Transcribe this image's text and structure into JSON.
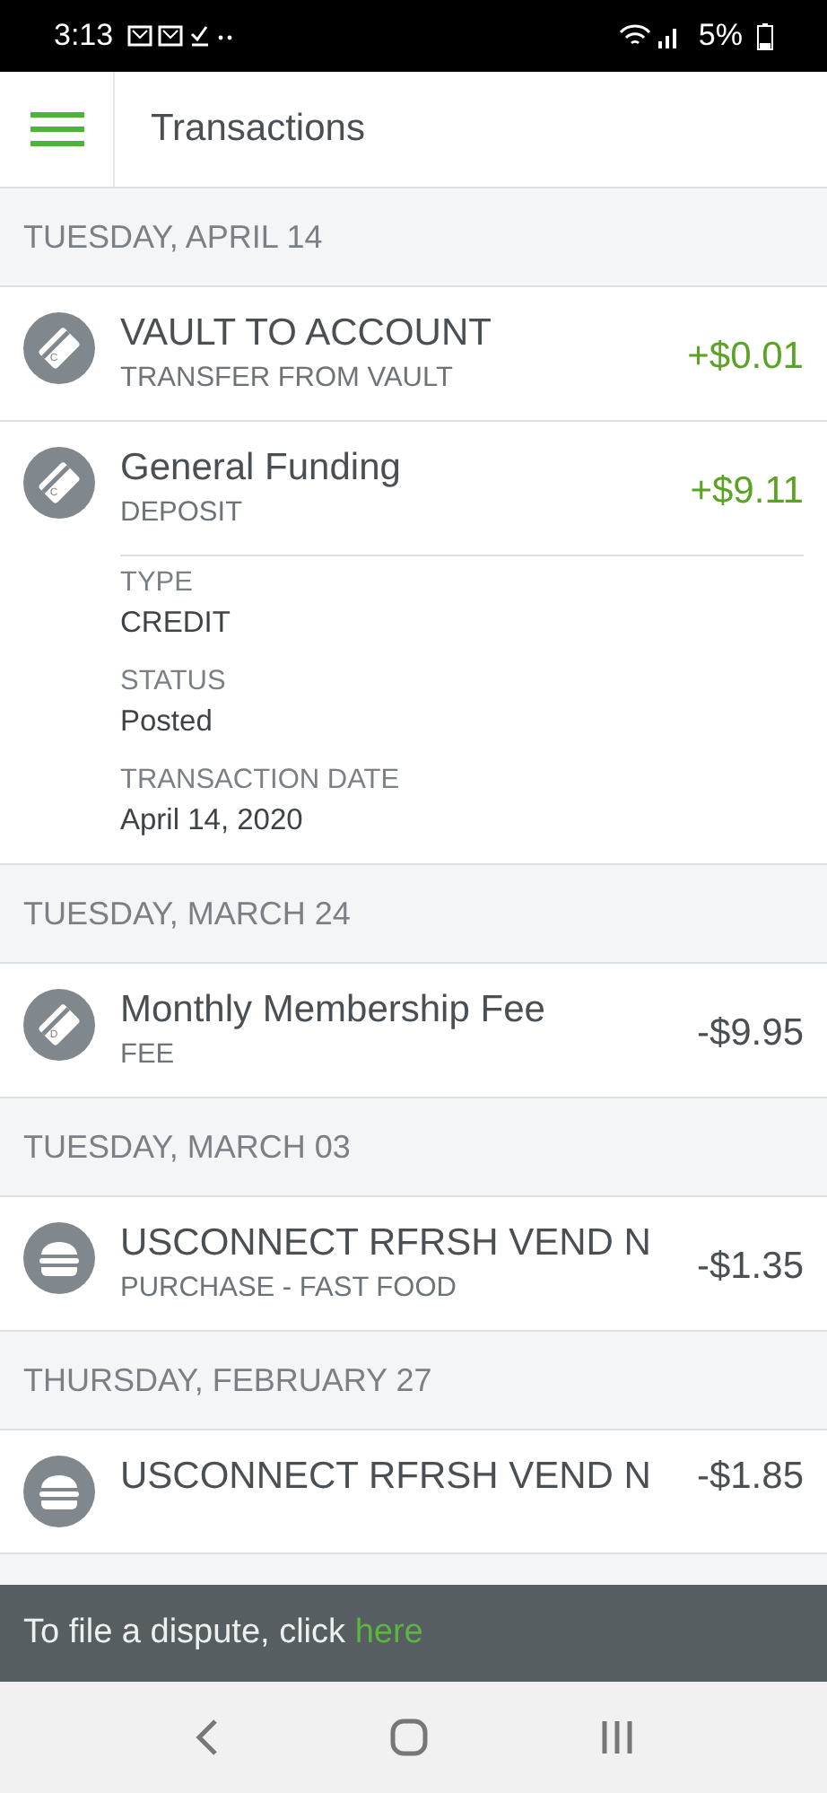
{
  "status_bar": {
    "time": "3:13",
    "battery": "5%"
  },
  "header": {
    "title": "Transactions"
  },
  "sections": [
    {
      "date": "TUESDAY, APRIL 14",
      "transactions": [
        {
          "kind": "card",
          "icon_letter": "C",
          "title": "VAULT TO ACCOUNT",
          "subtitle": "TRANSFER FROM VAULT",
          "amount": "+$0.01",
          "color": "#5ba423"
        },
        {
          "kind": "card",
          "icon_letter": "C",
          "title": "General Funding",
          "subtitle": "DEPOSIT",
          "amount": "+$9.11",
          "color": "#5ba423",
          "details": [
            {
              "label": "TYPE",
              "value": "CREDIT"
            },
            {
              "label": "STATUS",
              "value": "Posted"
            },
            {
              "label": "TRANSACTION DATE",
              "value": "April 14, 2020"
            }
          ]
        }
      ]
    },
    {
      "date": "TUESDAY, MARCH 24",
      "transactions": [
        {
          "kind": "card",
          "icon_letter": "D",
          "title": "Monthly Membership Fee",
          "subtitle": "FEE",
          "amount": "-$9.95",
          "color": "#4a4f54"
        }
      ]
    },
    {
      "date": "TUESDAY, MARCH 03",
      "transactions": [
        {
          "kind": "burger",
          "title": "USCONNECT RFRSH VEND N",
          "subtitle": "PURCHASE - FAST FOOD",
          "amount": "-$1.35",
          "color": "#4a4f54"
        }
      ]
    },
    {
      "date": "THURSDAY, FEBRUARY 27",
      "transactions": [
        {
          "kind": "burger",
          "title": "USCONNECT RFRSH VEND N",
          "amount": "-$1.85",
          "color": "#4a4f54"
        }
      ]
    }
  ],
  "banner": {
    "text": "To file a dispute, click ",
    "link": "here"
  }
}
